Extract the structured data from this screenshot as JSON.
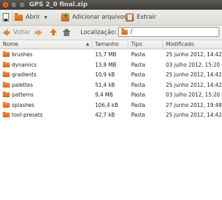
{
  "window": {
    "title": "GPS 2_0 final.zip"
  },
  "toolbar": {
    "open_label": "Abrir",
    "add_label": "Adicionar arquivos",
    "extract_label": "Extrair"
  },
  "location": {
    "back_label": "Voltar",
    "label": "Localização:",
    "path": "/"
  },
  "table": {
    "columns": [
      "Nome",
      "Tamanho",
      "Tipo",
      "Modificado"
    ],
    "sort_indicator": "▲",
    "rows": [
      {
        "name": "brushes",
        "size": "15,7 MB",
        "type": "Pasta",
        "modified": "25 junho 2012, 14:42"
      },
      {
        "name": "dynamics",
        "size": "13,8 MB",
        "type": "Pasta",
        "modified": "03 julho 2012, 15:20"
      },
      {
        "name": "gradients",
        "size": "10,9 kB",
        "type": "Pasta",
        "modified": "25 junho 2012, 14:42"
      },
      {
        "name": "palettes",
        "size": "51,4 kB",
        "type": "Pasta",
        "modified": "25 junho 2012, 14:42"
      },
      {
        "name": "patterns",
        "size": "9,4 MB",
        "type": "Pasta",
        "modified": "03 julho 2012, 15:20"
      },
      {
        "name": "splashes",
        "size": "106,4 kB",
        "type": "Pasta",
        "modified": "27 junho 2012, 19:48"
      },
      {
        "name": "tool-presets",
        "size": "42,7 kB",
        "type": "Pasta",
        "modified": "25 junho 2012, 14:42"
      }
    ]
  },
  "colors": {
    "folder": "#e8762a",
    "titlebar": "#3d3c37"
  }
}
